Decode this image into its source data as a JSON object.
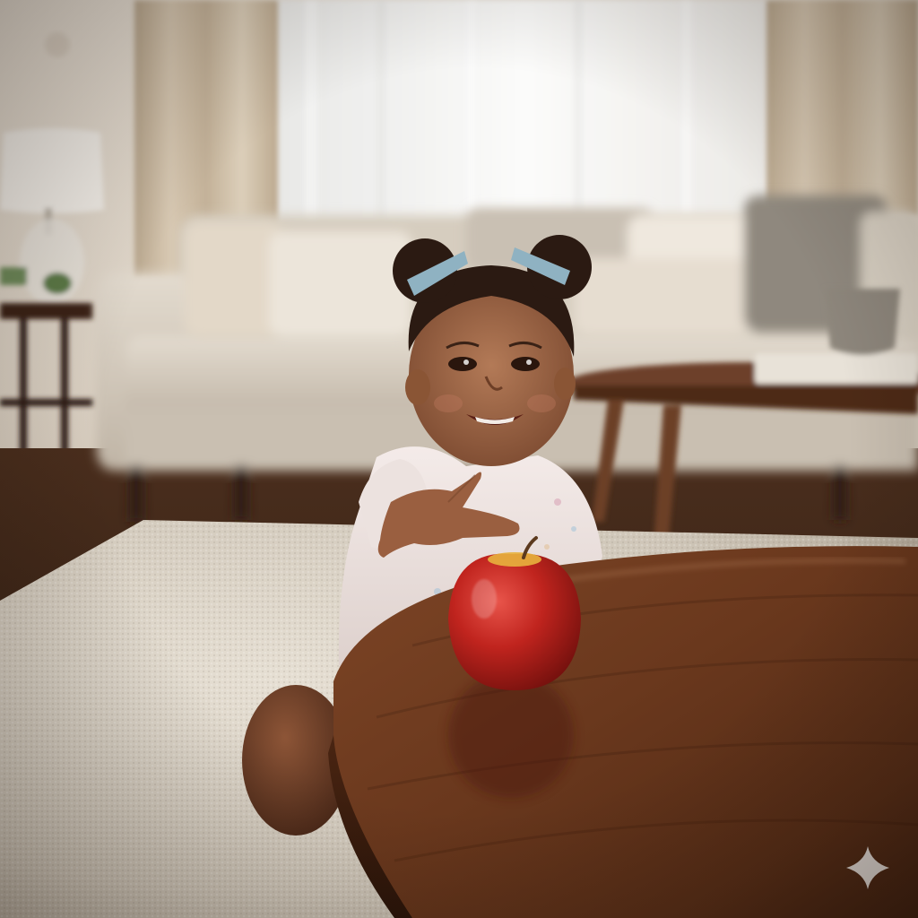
{
  "image": {
    "subject": "toddler-reaching-for-apple",
    "colors": {
      "wall": "#ece4d9",
      "window_light": "#f4f4f2",
      "curtain": "#cdbda6",
      "sofa": "#d9d0c3",
      "rug": "#d8d0c3",
      "wood_table": "#6b3a20",
      "apple_red": "#b3201b",
      "sweater": "#efe3e1",
      "skin": "#9a6446",
      "hair": "#2b1a12",
      "hair_bow": "#8fb2c2"
    },
    "icons": {
      "watermark": "sparkle-icon"
    }
  }
}
